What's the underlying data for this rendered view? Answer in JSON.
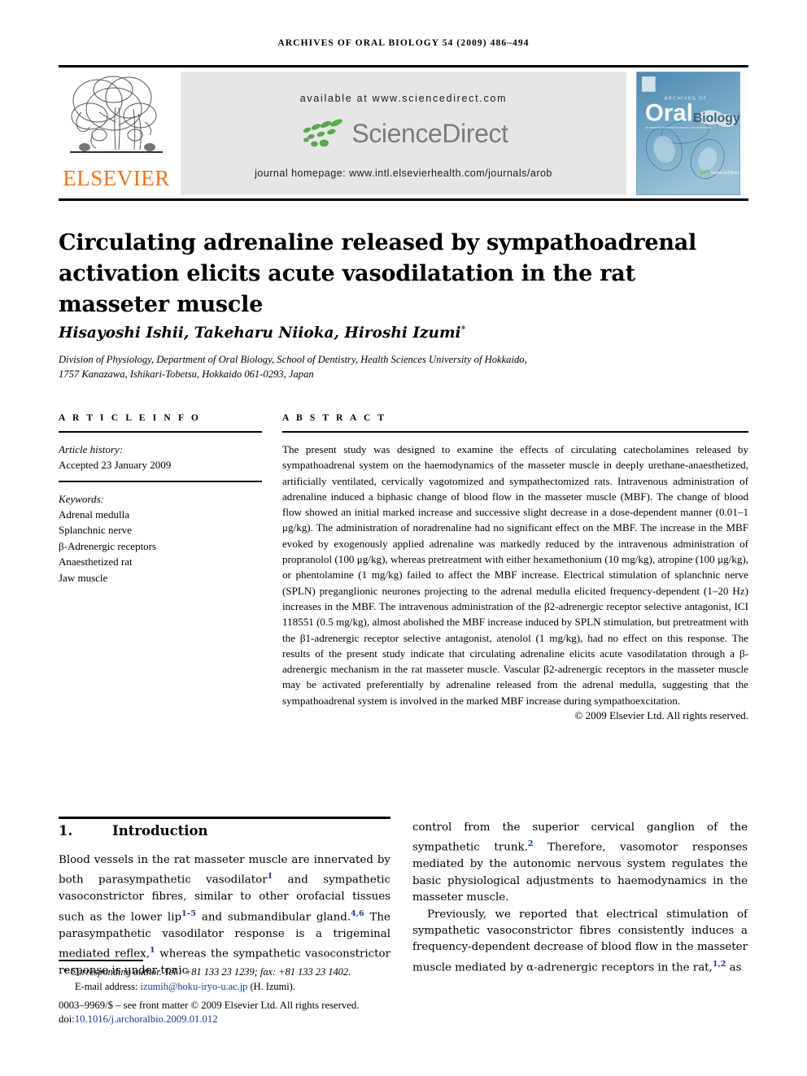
{
  "running_head": "ARCHIVES OF ORAL BIOLOGY 54 (2009) 486–494",
  "masthead": {
    "publisher_name": "ELSEVIER",
    "publisher_color": "#E87722",
    "available_at": "available at www.sciencedirect.com",
    "sciencedirect_wordmark": "ScienceDirect",
    "journal_homepage": "journal homepage: www.intl.elsevierhealth.com/journals/arob",
    "cover": {
      "kicker": "ARCHIVES OF",
      "title_primary": "Oral",
      "title_secondary": "Biology",
      "tagline": "An international journal for research into the biology of the oral tissues",
      "footer_mark": "ScienceDirect",
      "background_color": "#5b8fb5"
    }
  },
  "article": {
    "title": "Circulating adrenaline released by sympathoadrenal activation elicits acute vasodilatation in the rat masseter muscle",
    "authors": "Hisayoshi Ishii, Takeharu Niioka, Hiroshi Izumi",
    "author_footnote_marker": "*",
    "affiliation_line1": "Division of Physiology, Department of Oral Biology, School of Dentistry, Health Sciences University of Hokkaido,",
    "affiliation_line2": "1757 Kanazawa, Ishikari-Tobetsu, Hokkaido 061-0293, Japan"
  },
  "article_info": {
    "section_label": "A R T I C L E   I N F O",
    "history_heading": "Article history:",
    "history_value": "Accepted 23 January 2009",
    "keywords_heading": "Keywords:",
    "keywords": [
      "Adrenal medulla",
      "Splanchnic nerve",
      "β-Adrenergic receptors",
      "Anaesthetized rat",
      "Jaw muscle"
    ]
  },
  "abstract": {
    "section_label": "A B S T R A C T",
    "text": "The present study was designed to examine the effects of circulating catecholamines released by sympathoadrenal system on the haemodynamics of the masseter muscle in deeply urethane-anaesthetized, artificially ventilated, cervically vagotomized and sympathectomized rats. Intravenous administration of adrenaline induced a biphasic change of blood flow in the masseter muscle (MBF). The change of blood flow showed an initial marked increase and successive slight decrease in a dose-dependent manner (0.01–1 μg/kg). The administration of noradrenaline had no significant effect on the MBF. The increase in the MBF evoked by exogenously applied adrenaline was markedly reduced by the intravenous administration of propranolol (100 μg/kg), whereas pretreatment with either hexamethonium (10 mg/kg), atropine (100 μg/kg), or phentolamine (1 mg/kg) failed to affect the MBF increase. Electrical stimulation of splanchnic nerve (SPLN) preganglionic neurones projecting to the adrenal medulla elicited frequency-dependent (1–20 Hz) increases in the MBF. The intravenous administration of the β2-adrenergic receptor selective antagonist, ICI 118551 (0.5 mg/kg), almost abolished the MBF increase induced by SPLN stimulation, but pretreatment with the β1-adrenergic receptor selective antagonist, atenolol (1 mg/kg), had no effect on this response. The results of the present study indicate that circulating adrenaline elicits acute vasodilatation through a β-adrenergic mechanism in the rat masseter muscle. Vascular β2-adrenergic receptors in the masseter muscle may be activated preferentially by adrenaline released from the adrenal medulla, suggesting that the sympathoadrenal system is involved in the marked MBF increase during sympathoexcitation.",
    "copyright": "© 2009 Elsevier Ltd. All rights reserved."
  },
  "introduction": {
    "number": "1.",
    "heading": "Introduction",
    "left_paragraph_parts": {
      "p1": "Blood vessels in the rat masseter muscle are innervated by both parasympathetic vasodilator",
      "c1": "1",
      "p2": " and sympathetic vasoconstrictor fibres, similar to other orofacial tissues such as the lower lip",
      "c2": "1–5",
      "p3": " and submandibular gland.",
      "c3": "4,6",
      "p4": " The parasympathetic vasodilator response is a trigeminal mediated reflex,",
      "c4": "1",
      "p5": " whereas the sympathetic vasoconstrictor response is under tonic"
    },
    "right_paragraph_1": {
      "p1": "control from the superior cervical ganglion of the sympathetic trunk.",
      "c1": "2",
      "p2": " Therefore, vasomotor responses mediated by the autonomic nervous system regulates the basic physiological adjustments to haemodynamics in the masseter muscle."
    },
    "right_paragraph_2": {
      "p1": "Previously, we reported that electrical stimulation of sympathetic vasoconstrictor fibres consistently induces a frequency-dependent decrease of blood flow in the masseter muscle mediated by α-adrenergic receptors in the rat,",
      "c1": "1,2",
      "p2": " as"
    }
  },
  "footnotes": {
    "corresponding": "Corresponding author. Tel.: +81 133 23 1239; fax: +81 133 23 1402.",
    "email_label": "E-mail address:",
    "email": "izumih@hoku-iryo-u.ac.jp",
    "email_owner": "(H. Izumi).",
    "issn_line": "0003–9969/$ – see front matter © 2009 Elsevier Ltd. All rights reserved.",
    "doi_prefix": "doi:",
    "doi": "10.1016/j.archoralbio.2009.01.012"
  }
}
